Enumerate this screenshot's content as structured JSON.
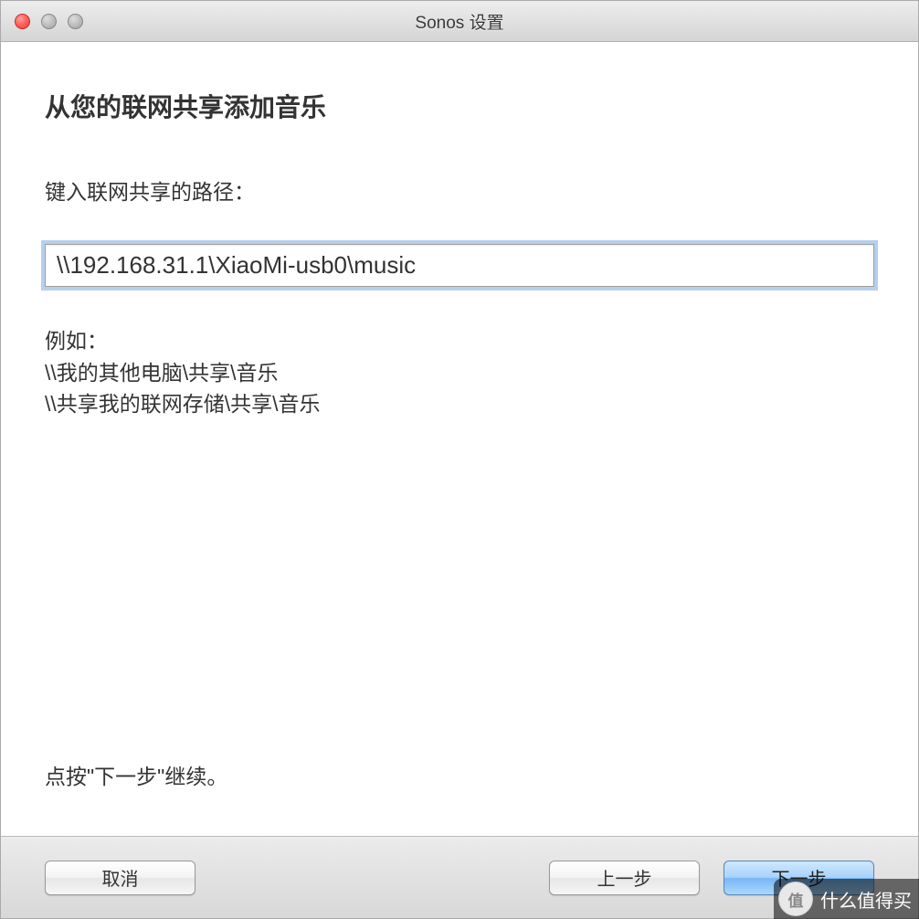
{
  "window": {
    "title": "Sonos 设置"
  },
  "main": {
    "heading": "从您的联网共享添加音乐",
    "field_label": "键入联网共享的路径：",
    "path_value": "\\\\192.168.31.1\\XiaoMi-usb0\\music",
    "example_label": "例如：",
    "example_line1": "\\\\我的其他电脑\\共享\\音乐",
    "example_line2": "\\\\共享我的联网存储\\共享\\音乐",
    "instruction": "点按\"下一步\"继续。"
  },
  "footer": {
    "cancel_label": "取消",
    "back_label": "上一步",
    "next_label": "下一步"
  },
  "watermark": {
    "badge": "值",
    "text": "什么值得买"
  }
}
